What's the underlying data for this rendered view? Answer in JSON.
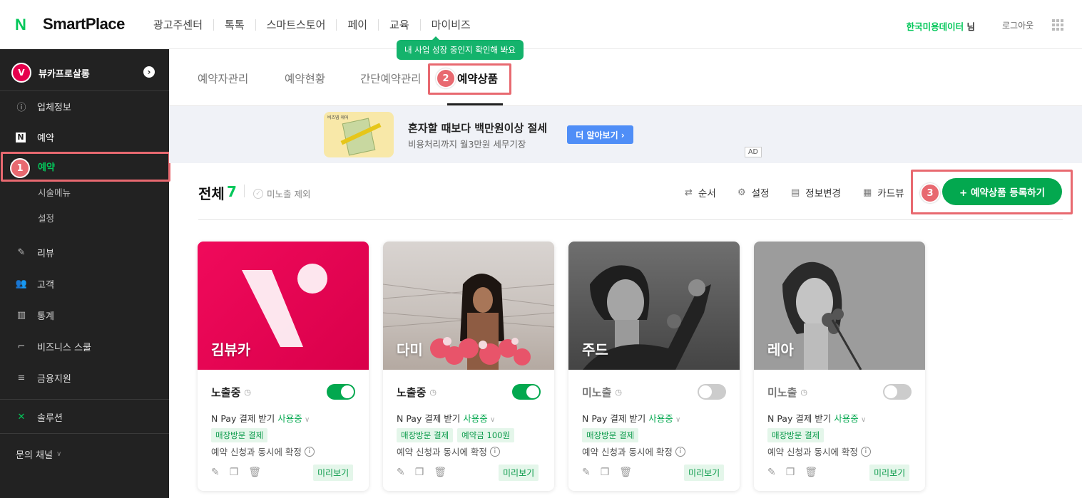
{
  "header": {
    "logo_mark": "N",
    "logo_text": "SmartPlace",
    "nav": [
      "광고주센터",
      "톡톡",
      "스마트스토어",
      "페이",
      "교육",
      "마이비즈"
    ],
    "user_name": "한국미용데이터",
    "user_suffix": "님",
    "logout": "로그아웃",
    "tooltip": "내 사업 성장 중인지 확인해 봐요"
  },
  "sidebar": {
    "store_name": "뷰카프로살롱",
    "store_logo": "V",
    "items": {
      "business_info": "업체정보",
      "reservation": "예약",
      "reservation_active": "예약",
      "menu": "시술메뉴",
      "settings": "설정",
      "review": "리뷰",
      "customer": "고객",
      "stats": "통계",
      "business_school": "비즈니스 스쿨",
      "finance": "금융지원",
      "solution": "솔루션",
      "inquiry": "문의 채널"
    }
  },
  "tabs": [
    "예약자관리",
    "예약현황",
    "간단예약관리",
    "예약상품"
  ],
  "active_tab": "예약상품",
  "ad": {
    "title": "혼자할 때보다 백만원이상 절세",
    "subtitle": "비용처리까지 월3만원 세무기장",
    "button": "더 알아보기 ›",
    "tag": "AD",
    "image_caption": "비즈넵 케어"
  },
  "summary": {
    "label": "전체",
    "count": "7",
    "exclude_hidden": "미노출 제외"
  },
  "toolbar": {
    "order": "순서",
    "settings": "설정",
    "edit_info": "정보변경",
    "card_view": "카드뷰",
    "register": "+ 예약상품 등록하기"
  },
  "annotations": {
    "badge1": "1",
    "badge2": "2",
    "badge3": "3"
  },
  "cards": [
    {
      "name": "김뷰카",
      "status": "노출중",
      "on": true,
      "pay_label": "N Pay 결제 받기",
      "pay_state": "사용중",
      "tags": [
        "매장방문 결제"
      ],
      "confirm": "예약 신청과 동시에 확정",
      "preview": "미리보기"
    },
    {
      "name": "다미",
      "status": "노출중",
      "on": true,
      "pay_label": "N Pay 결제 받기",
      "pay_state": "사용중",
      "tags": [
        "매장방문 결제",
        "예약금 100원"
      ],
      "confirm": "예약 신청과 동시에 확정",
      "preview": "미리보기"
    },
    {
      "name": "주드",
      "status": "미노출",
      "on": false,
      "pay_label": "N Pay 결제 받기",
      "pay_state": "사용중",
      "tags": [
        "매장방문 결제"
      ],
      "confirm": "예약 신청과 동시에 확정",
      "preview": "미리보기"
    },
    {
      "name": "레아",
      "status": "미노출",
      "on": false,
      "pay_label": "N Pay 결제 받기",
      "pay_state": "사용중",
      "tags": [
        "매장방문 결제"
      ],
      "confirm": "예약 신청과 동시에 확정",
      "preview": "미리보기"
    }
  ],
  "colors": {
    "brand": "#03c75a",
    "highlight": "#e86970",
    "sidebar": "#222222",
    "card_brand": "#e6004d"
  }
}
